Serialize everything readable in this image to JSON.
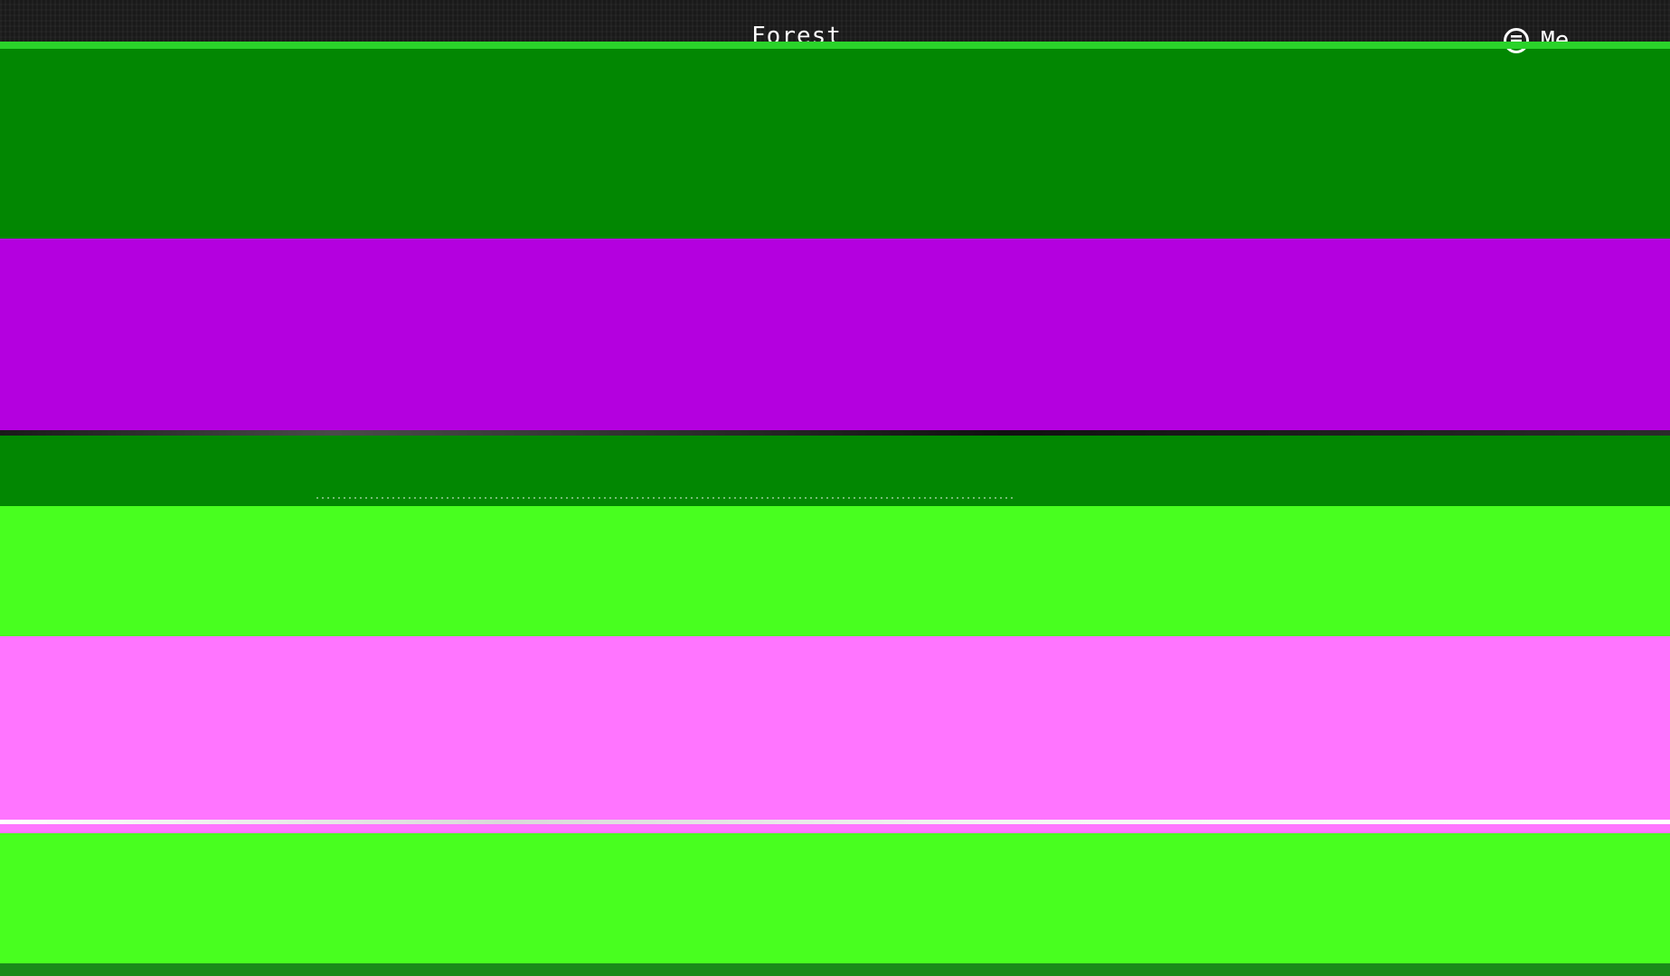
{
  "location": {
    "title": "Forest"
  },
  "menu": {
    "label": "Me",
    "icon": "menu-icon"
  },
  "glitch_bands": [
    {
      "color": "#028702"
    },
    {
      "color": "#b400df"
    },
    {
      "color": "#028702"
    },
    {
      "color": "#48ff1f"
    },
    {
      "color": "#ff75ff"
    },
    {
      "color": "#48ff1f"
    },
    {
      "color": "#1a8a1a"
    }
  ],
  "colors": {
    "topbar": "#1a1a1a",
    "text": "#ffffff"
  }
}
